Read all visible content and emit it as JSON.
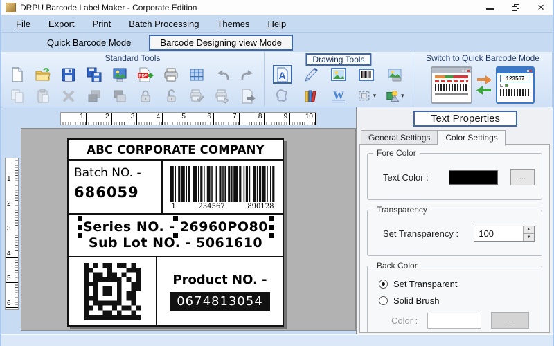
{
  "window": {
    "title": "DRPU Barcode Label Maker - Corporate Edition"
  },
  "menu": {
    "items": [
      {
        "label": "File",
        "underline": "F"
      },
      {
        "label": "Export",
        "underline": ""
      },
      {
        "label": "Print",
        "underline": ""
      },
      {
        "label": "Batch Processing",
        "underline": ""
      },
      {
        "label": "Themes",
        "underline": "T"
      },
      {
        "label": "Help",
        "underline": "H"
      }
    ]
  },
  "modes": {
    "quick": "Quick Barcode Mode",
    "designing": "Barcode Designing view Mode"
  },
  "toolbar": {
    "standard": {
      "title": "Standard Tools",
      "rows": [
        [
          "new-file",
          "open-folder",
          "save",
          "save-all",
          "export-image",
          "export-pdf",
          "print",
          "grid",
          "undo",
          "redo"
        ],
        [
          "copy",
          "paste",
          "delete",
          "bring-front",
          "send-back",
          "lock",
          "unlock",
          "print-preview",
          "print-setup",
          "close-page"
        ]
      ]
    },
    "drawing": {
      "title": "Drawing Tools",
      "rows": [
        [
          "text",
          "pencil",
          "picture",
          "barcode",
          "image-shape"
        ],
        [
          "freeform",
          "library",
          "watermark",
          "border",
          "shapes"
        ]
      ],
      "selected": "text",
      "dropdowns": [
        "border",
        "shapes"
      ]
    },
    "switch": {
      "title": "Switch to Quick Barcode Mode",
      "icon_number": "123567"
    }
  },
  "rulers": {
    "horizontal": [
      1,
      2,
      3,
      4,
      5,
      6,
      7,
      8,
      9,
      10
    ],
    "vertical": [
      1,
      2,
      3,
      4,
      5,
      6
    ]
  },
  "label": {
    "company": "ABC CORPORATE COMPANY",
    "batch_label": "Batch NO. -",
    "batch_value": "686059",
    "barcode_digits": [
      "1",
      "234567",
      "890128"
    ],
    "series_line": "Series NO. - 26960PO80",
    "sublot_line": "Sub Lot NO. - 5061610",
    "product_label": "Product NO. -",
    "product_value": "0674813054"
  },
  "properties": {
    "title": "Text Properties",
    "tabs": {
      "general": "General Settings",
      "color": "Color Settings"
    },
    "active_tab": "Color Settings",
    "fore_color": {
      "group": "Fore Color",
      "text_color_label": "Text Color :",
      "swatch_color": "#000000",
      "browse": "..."
    },
    "transparency": {
      "group": "Transparency",
      "label": "Set Transparency :",
      "value": "100"
    },
    "back_color": {
      "group": "Back Color",
      "radio_transparent": "Set Transparent",
      "radio_solid": "Solid Brush",
      "selected": "Set Transparent",
      "color_label": "Color :",
      "browse": "..."
    }
  },
  "colors": {
    "accent_blue_border": "#3c68aa",
    "toolbar_blue": "#c6daf2",
    "canvas_gray": "#b2b2b2",
    "label_ink": "#111111"
  }
}
